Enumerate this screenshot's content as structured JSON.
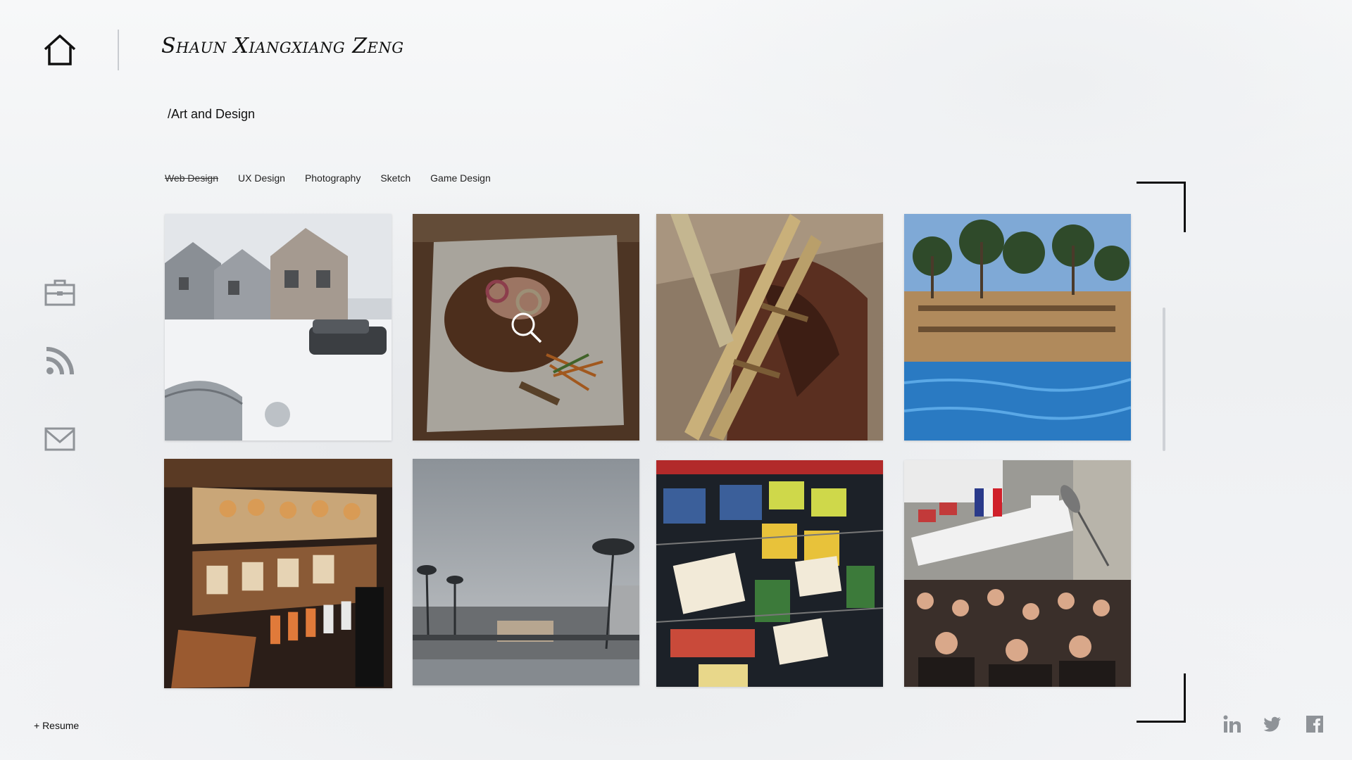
{
  "header": {
    "site_title": "Shaun Xiangxiang Zeng",
    "section_path": "/Art and Design"
  },
  "nav": {
    "home_icon": "home-icon",
    "side_icons": [
      "briefcase-icon",
      "rss-icon",
      "mail-icon"
    ],
    "resume_label": "+ Resume"
  },
  "tabs": [
    {
      "label": "Web Design",
      "active": true
    },
    {
      "label": "UX Design",
      "active": false
    },
    {
      "label": "Photography",
      "active": false
    },
    {
      "label": "Sketch",
      "active": false
    },
    {
      "label": "Game Design",
      "active": false
    }
  ],
  "gallery": {
    "items": [
      {
        "subject": "snowy-street"
      },
      {
        "subject": "plated-food",
        "hover_icon": "magnifier-icon"
      },
      {
        "subject": "wooden-ladder"
      },
      {
        "subject": "hotel-pool"
      },
      {
        "subject": "bakery-display"
      },
      {
        "subject": "palm-skyline"
      },
      {
        "subject": "grocery-shelf"
      },
      {
        "subject": "crowd-flags"
      }
    ]
  },
  "social": [
    "linkedin-icon",
    "twitter-icon",
    "facebook-icon"
  ],
  "colors": {
    "text": "#111111",
    "muted_icon": "#8f9398",
    "bracket": "#111111"
  }
}
